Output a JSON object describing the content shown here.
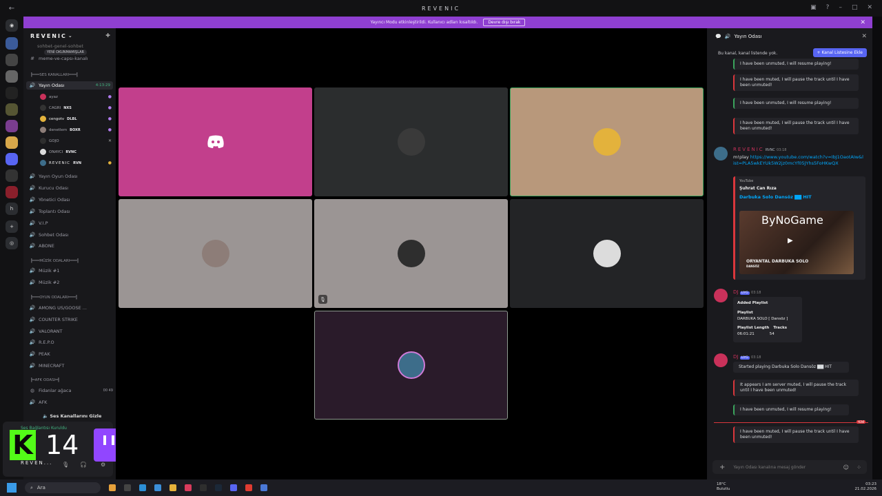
{
  "window": {
    "title": "REVENIC"
  },
  "banner": {
    "text": "Yayıncı Modu etkinleştirildi. Kullanıcı adları kısaltıldı.",
    "button": "Devre dışı bırak"
  },
  "server": {
    "name": "REVENIC",
    "unread_pill": "YENİ OKUNMAMIŞLAR",
    "top_channel": "sohbet-genel-sohbet",
    "top_channel2": "meme-ve-capsı-kanalı"
  },
  "sidebar": {
    "cat_voice": "╠═══SES KANALLARI═══╣",
    "active_channel": "Yayın Odası",
    "active_timer": "4:13:29",
    "members": [
      {
        "name": "ayaz",
        "tag": ""
      },
      {
        "name": "CAGRI",
        "tag": "NXS"
      },
      {
        "name": "cengotv",
        "tag": "DLBL"
      },
      {
        "name": "denetlem",
        "tag": "BOXR"
      },
      {
        "name": "GOJO",
        "tag": ""
      },
      {
        "name": "ONAYCI",
        "tag": "RVNC"
      },
      {
        "name": "REVENIC",
        "tag": "RVN"
      }
    ],
    "voice_channels": [
      "Yayın Oyun Odası",
      "Kurucu Odası",
      "Yönetici Odası",
      "Toplantı Odası",
      "V.I.P",
      "Sohbet Odası",
      "ABONE"
    ],
    "cat_music": "╠═══MÜZİK ODALARI═══╣",
    "music_channels": [
      "Müzik #1",
      "Müzik #2"
    ],
    "cat_game": "╠═══OYUN ODALARI═══╣",
    "game_channels": [
      "AMONG US/GOOSE ...",
      "COUNTER STRIKE",
      "VALORANT",
      "R.E.P.O",
      "PEAK",
      "MINECRAFT"
    ],
    "cat_afk": "╠═AFK ODASI═╣",
    "afk_channels": [
      "Fidanlar ağaca",
      "AFK"
    ],
    "afk_counts": "00 49",
    "hide_voice": "Ses Kanallarını Gizle"
  },
  "user_panel": {
    "status": "Ses Bağlantısı Kuruldu",
    "username": "REVEN..."
  },
  "overlay": {
    "kick_letter": "K",
    "kick_count": "14",
    "twitch_count": "1"
  },
  "stage": {
    "tiles": [
      {
        "bg": "#c23f8c",
        "avatar_bg": "#c23f8c",
        "icon": "discord"
      },
      {
        "bg": "#2b2d2e",
        "avatar_bg": "#3a3a3a",
        "icon": "user"
      },
      {
        "bg": "#b8987b",
        "avatar_bg": "#e3b23c",
        "icon": "user"
      },
      {
        "bg": "#9b9594",
        "avatar_bg": "#8d7d78",
        "icon": "user"
      },
      {
        "bg": "#9b9594",
        "avatar_bg": "#2e2e2e",
        "icon": "user"
      },
      {
        "bg": "#232426",
        "avatar_bg": "#dcdcdc",
        "icon": "user"
      },
      {
        "bg": "#2a1b2a",
        "avatar_bg": "#3d6d8a",
        "icon": "logo"
      }
    ]
  },
  "chat": {
    "channel_name": "Yayın Odası",
    "notice": "Bu kanal, kanal listende yok.",
    "add_button": "Kanal Listesine Ekle",
    "cards_top": [
      {
        "kind": "red",
        "text": "I have been unmuted, I will resume playing!"
      },
      {
        "kind": "red",
        "text": "I have been muted, I will pause the track until I have been unmuted!"
      },
      {
        "kind": "green",
        "text": "I have been unmuted, I will resume playing!"
      },
      {
        "kind": "red",
        "text": "I have been muted, I will pause the track until I have been unmuted!"
      }
    ],
    "msg1": {
      "author": "REVENIC",
      "tag": "RVNC",
      "time": "03:18",
      "text": "m!play",
      "link": "https://www.youtube.com/watch?v=IbJ1OaotAIw&list=PLA5wkEYUk5W2jz0mcYf05JYhs5FoHKwQX"
    },
    "embed": {
      "provider": "YouTube",
      "author": "Şuhrat Can Rıza",
      "title": "Darbuka Solo Dansöz ▇▇ HIT",
      "thumb_text": "ORYANTAL DARBUKA SOLO",
      "thumb_sub": "DANSÖZ",
      "watermark": "ByNoGame"
    },
    "msg2": {
      "author": "DJ",
      "tag": "LIYG",
      "time": "03:18",
      "pl_title": "Added Playlist",
      "pl_label": "Playlist",
      "pl_name": "DARBUKA SOLO [ Dansöz ]",
      "pl_len_label": "Playlist Length",
      "pl_tracks_label": "Tracks",
      "pl_len": "06:01:21",
      "pl_tracks": "54"
    },
    "msg3": {
      "author": "DJ",
      "tag": "LIYG",
      "time": "03:18",
      "started": "Started playing Darbuka Solo Dansöz ▇▇ HIT"
    },
    "cards_bottom": [
      {
        "kind": "red",
        "text": "It appears I am server muted, I will pause the track until I have been unmuted!"
      },
      {
        "kind": "green",
        "text": "I have been unmuted, I will resume playing!"
      },
      {
        "kind": "red",
        "text": "I have been muted, I will pause the track until I have been unmuted!"
      }
    ],
    "new_label": "YENİ",
    "input_placeholder": "Yayın Odası kanalına mesaj gönder"
  },
  "taskbar": {
    "search": "Ara",
    "weather_temp": "18°C",
    "weather_desc": "Bulutlu",
    "time": "03:23",
    "date": "21.02.2026"
  }
}
